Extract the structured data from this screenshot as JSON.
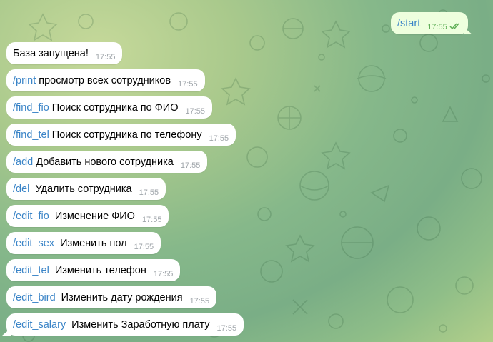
{
  "colors": {
    "command_link": "#3a84c7",
    "incoming_bubble": "#ffffff",
    "outgoing_bubble": "#eeffde",
    "time_text": "#a0a6ab",
    "outgoing_time": "#5eae55"
  },
  "outgoing": {
    "command": "/start",
    "time": "17:55",
    "status_icon": "double-check-icon"
  },
  "messages": [
    {
      "command": "",
      "text": "База запущена!",
      "time": "17:55"
    },
    {
      "command": "/print",
      "text": "просмотр всех сотрудников",
      "time": "17:55"
    },
    {
      "command": "/find_fio",
      "text": "Поиск сотрудника по ФИО",
      "time": "17:55"
    },
    {
      "command": "/find_tel",
      "text": "Поиск сотрудника по телефону",
      "time": "17:55"
    },
    {
      "command": "/add",
      "text": "Добавить нового сотрудника",
      "time": "17:55"
    },
    {
      "command": "/del",
      "text": " Удалить сотрудника",
      "time": "17:55"
    },
    {
      "command": "/edit_fio",
      "text": " Изменение ФИО",
      "time": "17:55"
    },
    {
      "command": "/edit_sex",
      "text": " Изменить пол",
      "time": "17:55"
    },
    {
      "command": "/edit_tel",
      "text": " Изменить телефон",
      "time": "17:55"
    },
    {
      "command": "/edit_bird",
      "text": " Изменить дату рождения",
      "time": "17:55"
    },
    {
      "command": "/edit_salary",
      "text": " Изменить Заработную плату",
      "time": "17:55"
    }
  ]
}
